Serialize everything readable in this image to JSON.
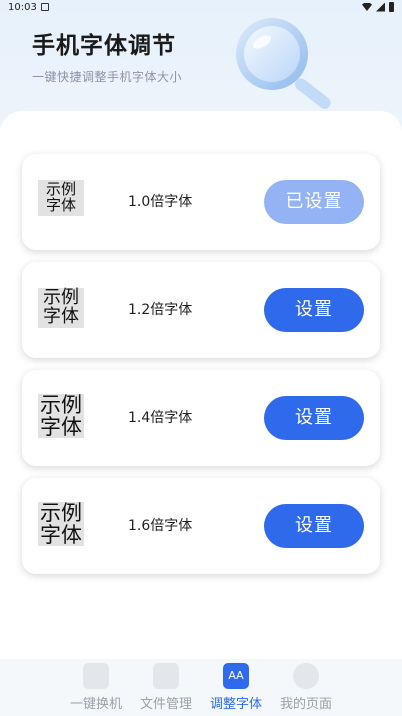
{
  "status_bar": {
    "time": "10:03"
  },
  "header": {
    "title": "手机字体调节",
    "subtitle": "一键快捷调整手机字体大小"
  },
  "font_options": [
    {
      "sample_line1": "示例",
      "sample_line2": "字体",
      "size_label": "1.0倍字体",
      "button_label": "已设置",
      "is_set": true
    },
    {
      "sample_line1": "示例",
      "sample_line2": "字体",
      "size_label": "1.2倍字体",
      "button_label": "设置",
      "is_set": false
    },
    {
      "sample_line1": "示例",
      "sample_line2": "字体",
      "size_label": "1.4倍字体",
      "button_label": "设置",
      "is_set": false
    },
    {
      "sample_line1": "示例",
      "sample_line2": "字体",
      "size_label": "1.6倍字体",
      "button_label": "设置",
      "is_set": false
    }
  ],
  "bottom_nav": {
    "items": [
      {
        "label": "一键换机",
        "icon": "phone-switch-icon",
        "active": false
      },
      {
        "label": "文件管理",
        "icon": "folder-icon",
        "active": false
      },
      {
        "label": "调整字体",
        "icon": "font-size-icon",
        "icon_text": "AA",
        "active": true
      },
      {
        "label": "我的页面",
        "icon": "user-icon",
        "active": false
      }
    ]
  },
  "colors": {
    "accent": "#2f69ec",
    "accent_disabled": "#94b3f5",
    "inactive_nav": "#9aa0a8"
  }
}
